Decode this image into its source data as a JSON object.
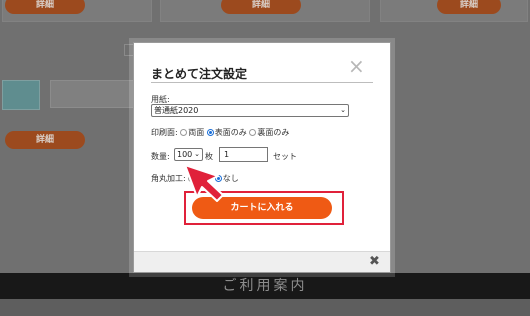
{
  "background": {
    "detail_buttons": [
      "詳細",
      "詳細",
      "詳細",
      "詳細"
    ],
    "footer_text": "ご利用案内"
  },
  "modal": {
    "title": "まとめて注文設定",
    "paper": {
      "label": "用紙:",
      "selected": "普通紙2020"
    },
    "print_side": {
      "label": "印刷面:",
      "options": [
        "両面",
        "表面のみ",
        "裏面のみ"
      ],
      "selected_index": 1
    },
    "quantity": {
      "label": "数量:",
      "select_value": "100",
      "unit": "枚",
      "set_value": "1",
      "set_unit": "セット"
    },
    "rounded_corners": {
      "label": "角丸加工:",
      "options": [
        "あり",
        "なし"
      ],
      "selected_index": 1
    },
    "cart_button": "カートに入れる",
    "close_icon": "close-icon",
    "footer_close_icon": "close-icon"
  },
  "colors": {
    "accent": "#ef5a14",
    "highlight": "#e0213a",
    "radio": "#1a6fd8"
  }
}
